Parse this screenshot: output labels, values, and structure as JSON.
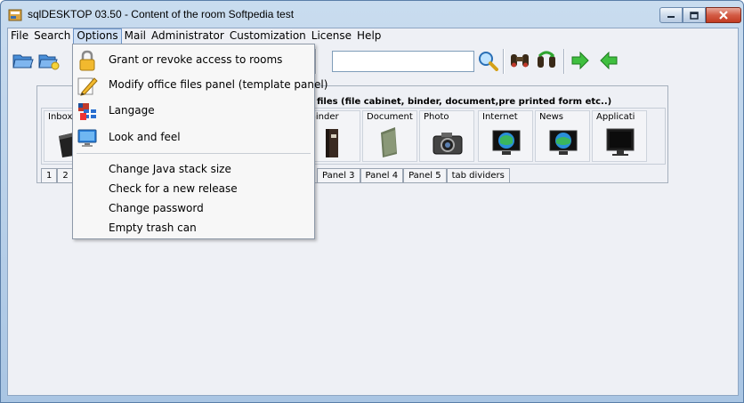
{
  "window": {
    "title": "sqlDESKTOP 03.50  -  Content of the room   Softpedia test"
  },
  "menubar": {
    "items": [
      "File",
      "Search",
      "Options",
      "Mail",
      "Administrator",
      "Customization",
      "License",
      "Help"
    ],
    "active": "Options"
  },
  "toolbar": {
    "search_value": "",
    "icons": [
      "open-folder-icon",
      "new-folder-icon",
      "search-icon",
      "binoculars-icon",
      "binoculars-refresh-icon",
      "arrow-forward-icon",
      "arrow-back-icon"
    ]
  },
  "panel": {
    "header": "files (file cabinet, binder, document,pre printed form etc..)",
    "tiles": [
      {
        "label": "Inbox"
      },
      {
        "label": "Binder"
      },
      {
        "label": "Document"
      },
      {
        "label": "Photo"
      },
      {
        "label": "Internet"
      },
      {
        "label": "News"
      },
      {
        "label": "Applicati"
      }
    ],
    "tabs_left": [
      "1",
      "2"
    ],
    "tabs_right": [
      "Panel 3",
      "Panel 4",
      "Panel 5",
      "tab dividers"
    ]
  },
  "options_menu": {
    "items": [
      {
        "label": "Grant or revoke access to rooms",
        "icon": "lock-icon"
      },
      {
        "label": "Modify office files panel (template panel)",
        "icon": "pencil-icon"
      },
      {
        "label": "Langage",
        "icon": "language-flags-icon"
      },
      {
        "label": "Look and feel",
        "icon": "monitor-icon"
      },
      {
        "label": "Change Java stack size",
        "icon": ""
      },
      {
        "label": "Check for a new release",
        "icon": ""
      },
      {
        "label": "Change password",
        "icon": ""
      },
      {
        "label": "Empty trash can",
        "icon": ""
      }
    ]
  },
  "colors": {
    "titlebar": "#b4cde8",
    "menu_highlight": "#cfe0f5",
    "close_button": "#c94a33",
    "arrow_green": "#2fa52f"
  }
}
